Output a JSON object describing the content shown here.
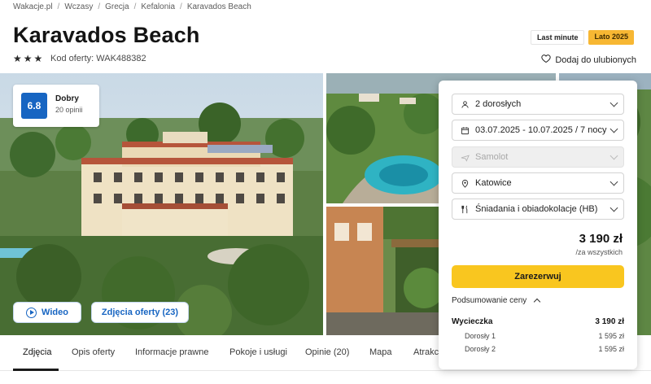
{
  "breadcrumb": [
    "Wakacje.pl",
    "Wczasy",
    "Grecja",
    "Kefalonia",
    "Karavados Beach"
  ],
  "hotel": {
    "name": "Karavados Beach",
    "stars": 3,
    "offer_code": "Kod oferty: WAK488382"
  },
  "badges": {
    "last_minute": "Last minute",
    "season": "Lato 2025"
  },
  "favorite_label": "Dodaj do ulubionych",
  "rating": {
    "score": "6.8",
    "label": "Dobry",
    "count": "20 opinii"
  },
  "gallery": {
    "video_label": "Wideo",
    "photos_label": "Zdjęcia oferty (23)"
  },
  "tabs": [
    "Zdjęcia",
    "Opis oferty",
    "Informacje prawne",
    "Pokoje i usługi",
    "Opinie (20)",
    "Mapa",
    "Atrakc"
  ],
  "booking": {
    "guests": "2 dorosłych",
    "dates": "03.07.2025 - 10.07.2025 / 7 nocy",
    "transport": "Samolot",
    "departure": "Katowice",
    "board": "Śniadania i obiadokolacje (HB)",
    "price": "3 190 zł",
    "price_note": "/za wszystkich",
    "book_label": "Zarezerwuj",
    "summary_label": "Podsumowanie ceny",
    "summary": {
      "trip_label": "Wycieczka",
      "trip_value": "3 190 zł",
      "lines": [
        {
          "label": "Dorosły 1",
          "value": "1 595 zł"
        },
        {
          "label": "Dorosły 2",
          "value": "1 595 zł"
        }
      ]
    }
  },
  "colors": {
    "accent_blue": "#1765c2",
    "book_yellow": "#f9c61f",
    "season_badge": "#f7b733"
  }
}
